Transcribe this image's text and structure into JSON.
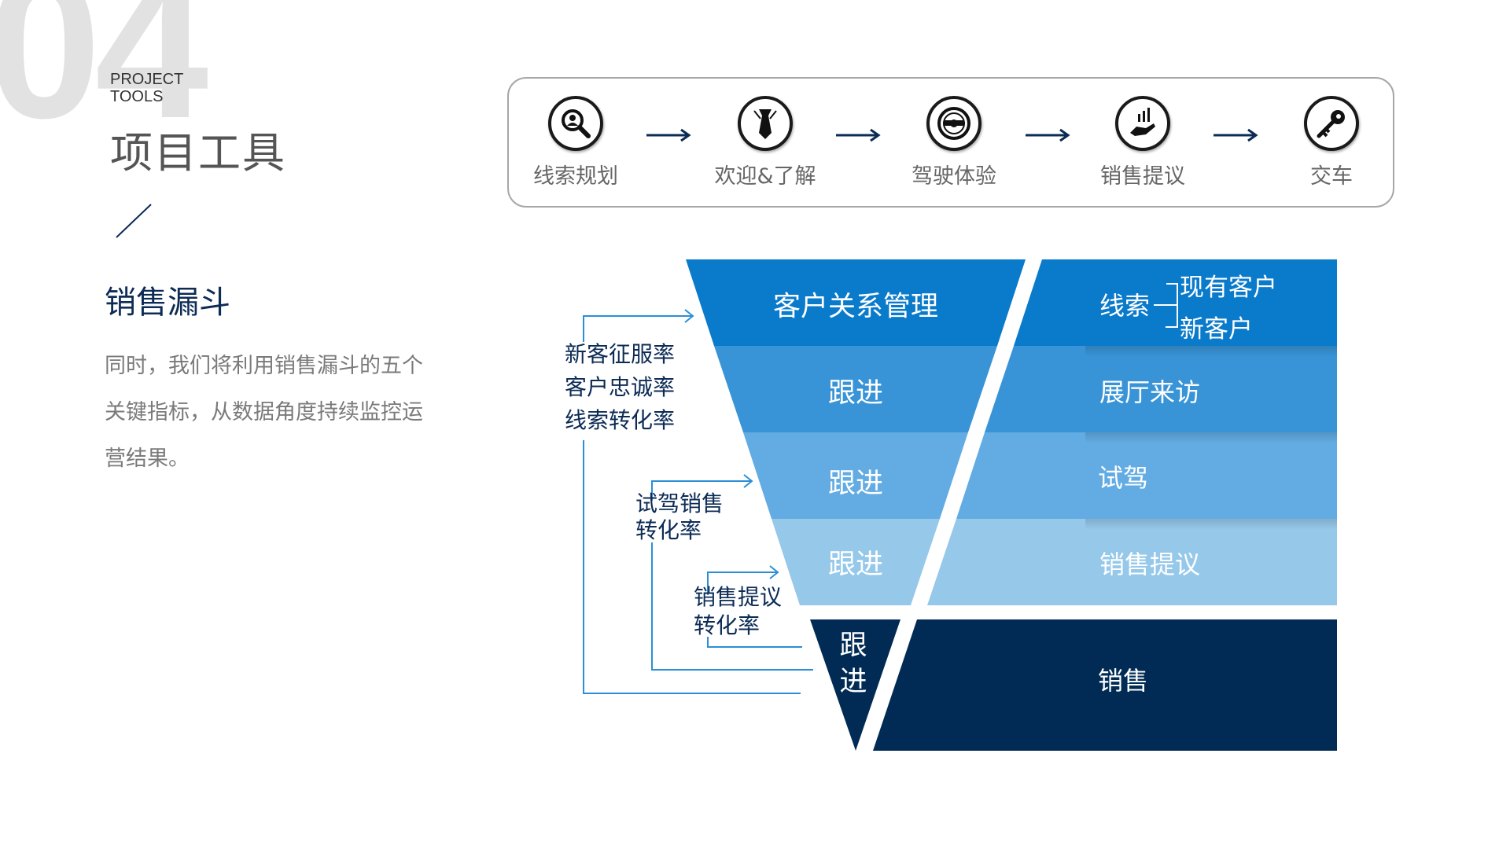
{
  "header": {
    "number": "04",
    "english": [
      "PROJECT",
      "TOOLS"
    ],
    "title": "项目工具"
  },
  "section": {
    "title": "销售漏斗",
    "description": "同时，我们将利用销售漏斗的五个关键指标，从数据角度持续监控运营结果。"
  },
  "process": {
    "steps": [
      {
        "label": "线索规划",
        "icon": "search-person-icon"
      },
      {
        "label": "欢迎&了解",
        "icon": "necktie-icon"
      },
      {
        "label": "驾驶体验",
        "icon": "steering-wheel-icon"
      },
      {
        "label": "销售提议",
        "icon": "hand-chart-icon"
      },
      {
        "label": "交车",
        "icon": "key-icon"
      }
    ],
    "arrow_icon": "right-arrow-icon"
  },
  "funnel": {
    "left_layers": [
      "客户关系管理",
      "跟进",
      "跟进",
      "跟进"
    ],
    "bottom_left": [
      "跟",
      "进"
    ],
    "right_layers": [
      "线索",
      "展厅来访",
      "试驾",
      "销售提议",
      "销售"
    ],
    "lead_branches": [
      "现有客户",
      "新客户"
    ],
    "conversion_labels": {
      "outer": [
        "新客征服率",
        "客户忠诚率",
        "线索转化率"
      ],
      "middle": [
        "试驾销售",
        "转化率"
      ],
      "inner": [
        "销售提议",
        "转化率"
      ]
    },
    "colors": {
      "layer1": "#0a7acb",
      "layer2": "#3894d7",
      "layer3": "#62ace3",
      "layer4": "#96c8ea",
      "bottom": "#012b55",
      "bracket": "#2a8fd6"
    }
  }
}
